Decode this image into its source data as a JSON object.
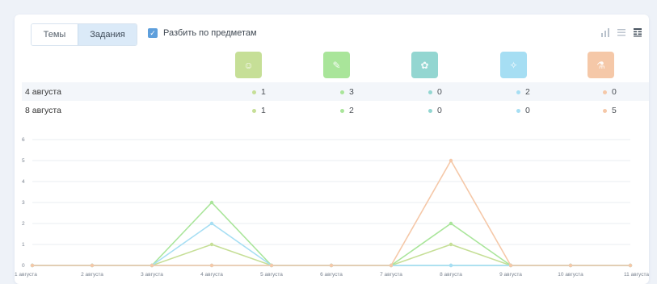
{
  "toolbar": {
    "tabs": [
      {
        "label": "Темы",
        "active": false
      },
      {
        "label": "Задания",
        "active": true
      }
    ],
    "split_checkbox": {
      "label": "Разбить по предметам",
      "checked": true
    }
  },
  "view_toggles": [
    "bar-chart-icon",
    "list-icon",
    "table-icon"
  ],
  "subjects": [
    {
      "icon": "subject-1-icon",
      "color": "#c6df97"
    },
    {
      "icon": "subject-2-icon",
      "color": "#a9e59a"
    },
    {
      "icon": "subject-3-icon",
      "color": "#93d6d1"
    },
    {
      "icon": "subject-4-icon",
      "color": "#a6def3"
    },
    {
      "icon": "subject-5-icon",
      "color": "#f5c8a8"
    }
  ],
  "rows": [
    {
      "date": "4 августа",
      "values": [
        "1",
        "3",
        "0",
        "2",
        "0"
      ]
    },
    {
      "date": "8 августа",
      "values": [
        "1",
        "2",
        "0",
        "0",
        "5"
      ]
    }
  ],
  "chart_data": {
    "type": "line",
    "x": [
      "1 августа",
      "2 августа",
      "3 августа",
      "4 августа",
      "5 августа",
      "6 августа",
      "7 августа",
      "8 августа",
      "9 августа",
      "10 августа",
      "11 августа"
    ],
    "ylim": [
      0,
      6
    ],
    "yticks": [
      "0",
      "1",
      "2",
      "3",
      "4",
      "5",
      "6"
    ],
    "grid": true,
    "series": [
      {
        "color": "#c6df97",
        "values": [
          0,
          0,
          0,
          1,
          0,
          0,
          0,
          1,
          0,
          0,
          0
        ]
      },
      {
        "color": "#a9e59a",
        "values": [
          0,
          0,
          0,
          3,
          0,
          0,
          0,
          2,
          0,
          0,
          0
        ]
      },
      {
        "color": "#93d6d1",
        "values": [
          0,
          0,
          0,
          0,
          0,
          0,
          0,
          0,
          0,
          0,
          0
        ]
      },
      {
        "color": "#a6def3",
        "values": [
          0,
          0,
          0,
          2,
          0,
          0,
          0,
          0,
          0,
          0,
          0
        ]
      },
      {
        "color": "#f5c8a8",
        "values": [
          0,
          0,
          0,
          0,
          0,
          0,
          0,
          5,
          0,
          0,
          0
        ]
      }
    ]
  }
}
